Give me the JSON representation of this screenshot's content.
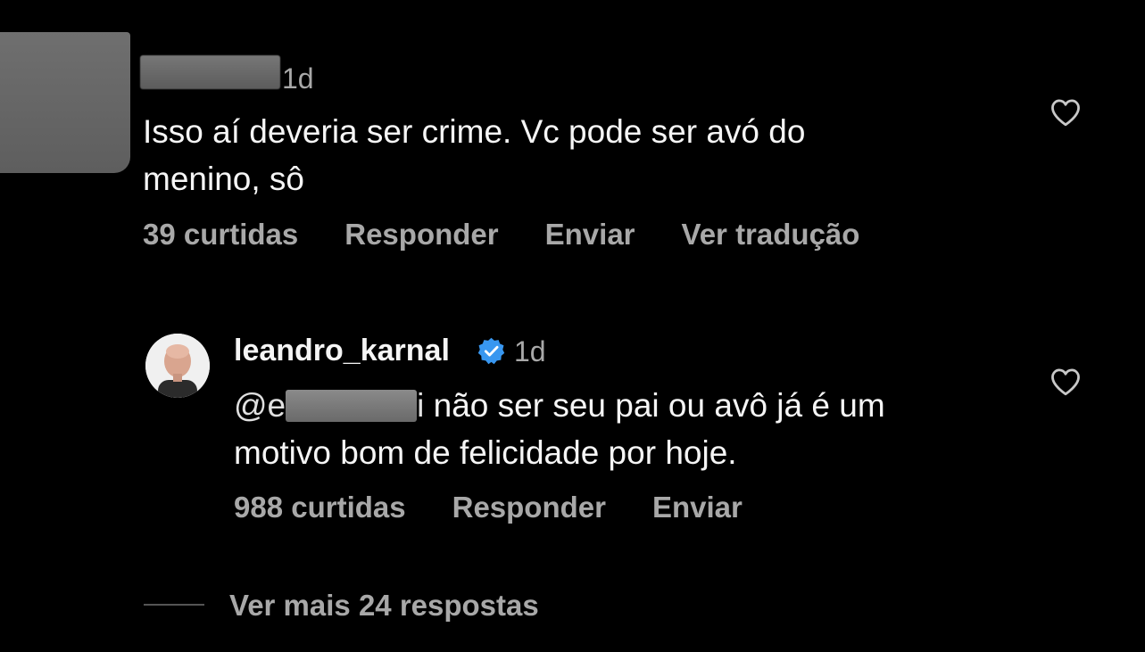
{
  "comment": {
    "time": "1d",
    "text_line1": "Isso aí deveria ser crime. Vc pode ser avó do",
    "text_line2": "menino, sô",
    "likes": "39 curtidas",
    "reply_label": "Responder",
    "send_label": "Enviar",
    "translate_label": "Ver tradução"
  },
  "reply": {
    "username": "leandro_karnal",
    "time": "1d",
    "mention_prefix": "@e",
    "mention_suffix": "i",
    "text_line1_rest": " não ser seu pai ou avô já é um",
    "text_line2": "motivo bom de felicidade por hoje.",
    "likes": "988 curtidas",
    "reply_label": "Responder",
    "send_label": "Enviar"
  },
  "view_more": "Ver mais 24 respostas",
  "colors": {
    "background": "#000000",
    "text": "#f5f5f5",
    "secondary": "#a8a8a8",
    "verified": "#3897f0"
  },
  "icons": [
    "heart-icon",
    "verified-badge-icon"
  ]
}
